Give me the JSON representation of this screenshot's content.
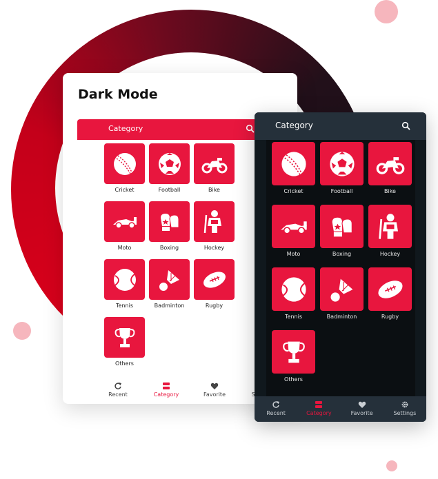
{
  "title": "Dark Mode",
  "header": {
    "label": "Category"
  },
  "categories": [
    {
      "label": "Cricket",
      "icon": "cricket-ball-icon"
    },
    {
      "label": "Football",
      "icon": "football-icon"
    },
    {
      "label": "Bike",
      "icon": "motorbike-icon"
    },
    {
      "label": "Moto",
      "icon": "race-car-icon"
    },
    {
      "label": "Boxing",
      "icon": "boxing-gloves-icon"
    },
    {
      "label": "Hockey",
      "icon": "hockey-player-icon"
    },
    {
      "label": "Tennis",
      "icon": "tennis-ball-icon"
    },
    {
      "label": "Badminton",
      "icon": "shuttlecock-icon"
    },
    {
      "label": "Rugby",
      "icon": "rugby-ball-icon"
    },
    {
      "label": "Others",
      "icon": "trophy-icon"
    }
  ],
  "nav": [
    {
      "label": "Recent",
      "icon": "refresh-icon"
    },
    {
      "label": "Category",
      "icon": "category-icon"
    },
    {
      "label": "Favorite",
      "icon": "heart-icon"
    },
    {
      "label": "Settings",
      "icon": "gear-icon"
    }
  ],
  "colors": {
    "accent": "#e8163e",
    "dark_bg": "#10181d",
    "dark_bar": "#25303a"
  }
}
